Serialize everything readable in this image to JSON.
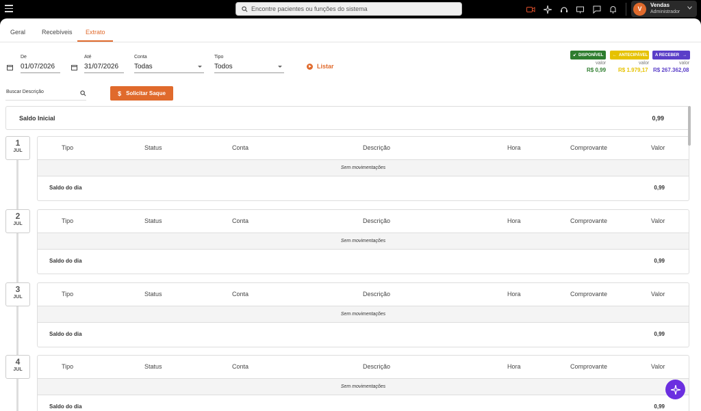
{
  "topbar": {
    "search_placeholder": "Encontre pacientes ou funções do sistema",
    "user": {
      "initial": "V",
      "name": "Vendas",
      "role": "Administrador"
    }
  },
  "tabs": [
    {
      "label": "Geral"
    },
    {
      "label": "Recebíveis"
    },
    {
      "label": "Extrato",
      "active": true
    }
  ],
  "filters": {
    "de_label": "De",
    "de_value": "01/07/2026",
    "ate_label": "Até",
    "ate_value": "31/07/2026",
    "conta_label": "Conta",
    "conta_value": "Todas",
    "tipo_label": "Tipo",
    "tipo_value": "Todos",
    "listar": "Listar",
    "search_label": "Buscar Descrição",
    "saque_button": "Solicitar Saque"
  },
  "badges": [
    {
      "label": "DISPONÍVEL",
      "sub": "valor",
      "value": "R$ 0,99",
      "color": "#2e7d2e"
    },
    {
      "label": "ANTECIPÁVEL",
      "sub": "valor",
      "value": "R$ 1.979,17",
      "color": "#e6c200"
    },
    {
      "label": "A RECEBER",
      "sub": "valor",
      "value": "R$ 267.362,08",
      "color": "#5a3ec8"
    }
  ],
  "saldo_inicial": {
    "label": "Saldo Inicial",
    "value": "0,99"
  },
  "columns": [
    "Tipo",
    "Status",
    "Conta",
    "Descrição",
    "Hora",
    "Comprovante",
    "Valor"
  ],
  "days": [
    {
      "day": "1",
      "month": "JUL",
      "empty": "Sem movimentações",
      "saldo_label": "Saldo do dia",
      "saldo": "0,99"
    },
    {
      "day": "2",
      "month": "JUL",
      "empty": "Sem movimentações",
      "saldo_label": "Saldo do dia",
      "saldo": "0,99"
    },
    {
      "day": "3",
      "month": "JUL",
      "empty": "Sem movimentações",
      "saldo_label": "Saldo do dia",
      "saldo": "0,99"
    },
    {
      "day": "4",
      "month": "JUL",
      "empty": "Sem movimentações",
      "saldo_label": "Saldo do dia",
      "saldo": "0,99"
    }
  ],
  "colors": {
    "accent": "#e06a2c",
    "fab": "#6b2fe0"
  }
}
